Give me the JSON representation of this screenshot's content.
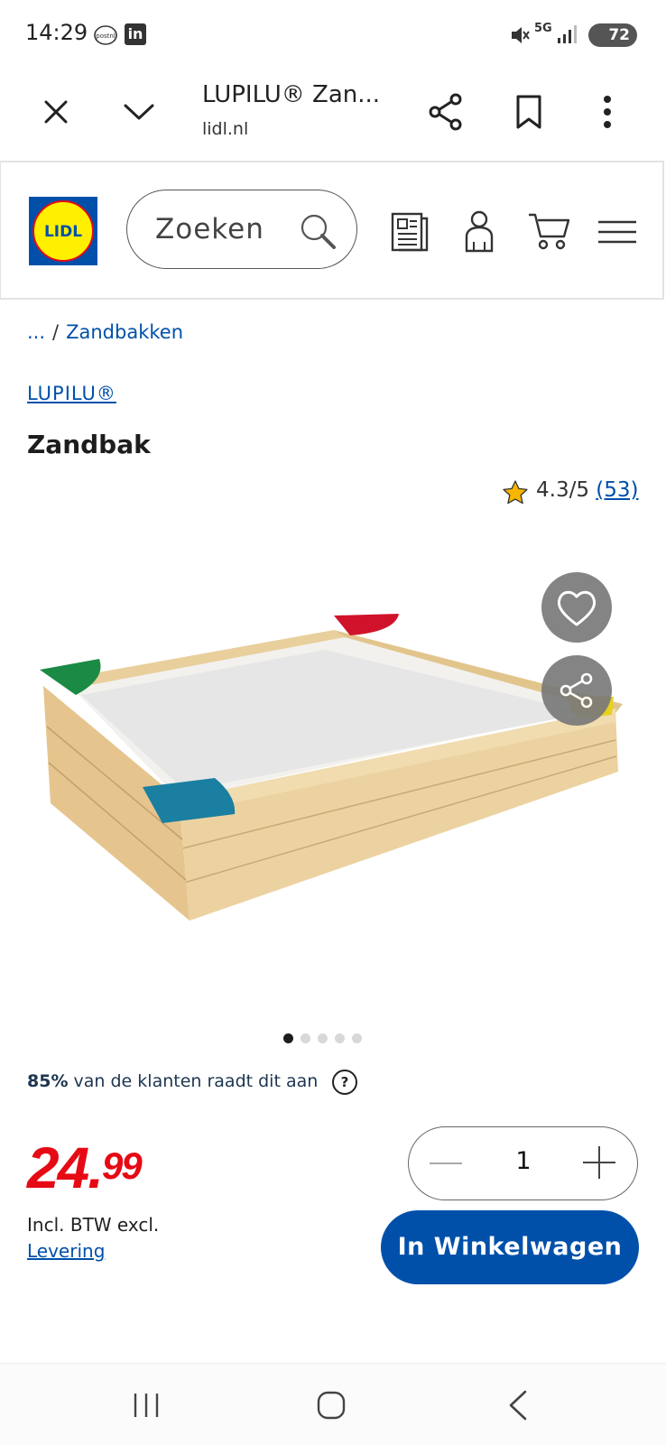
{
  "status_bar": {
    "time": "14:29",
    "network": "5G",
    "battery": "72",
    "icons": [
      "postnl-icon",
      "linkedin-icon",
      "mute-vibrate-icon",
      "signal-icon"
    ]
  },
  "browser": {
    "tab_title": "LUPILU® Zan...",
    "url": "lidl.nl",
    "icons": [
      "close-icon",
      "chevron-down-icon",
      "share-icon",
      "bookmark-icon",
      "more-vert-icon"
    ]
  },
  "header": {
    "logo_text": "LIDL",
    "search_placeholder": "Zoeken",
    "icons": [
      "leaflet-icon",
      "account-icon",
      "cart-icon",
      "menu-icon"
    ]
  },
  "breadcrumb": {
    "ellipsis": "...",
    "separator": "/",
    "current": "Zandbakken"
  },
  "product": {
    "brand": "LUPILU®",
    "title": "Zandbak",
    "rating_text": "4.3/5",
    "review_count": "(53)",
    "rating_value": 4.3,
    "gallery_count": 5,
    "gallery_active": 1,
    "recommend_pct": "85%",
    "recommend_text": " van de klanten raadt dit aan",
    "help_label": "?",
    "price_whole": "24.",
    "price_cents": "99",
    "price_note": "Incl. BTW excl.",
    "delivery_link": "Levering",
    "quantity": "1",
    "add_to_cart": "In Winkelwagen"
  },
  "colors": {
    "brand_blue": "#0050aa",
    "price_red": "#e60a14",
    "logo_yellow": "#fff000"
  }
}
